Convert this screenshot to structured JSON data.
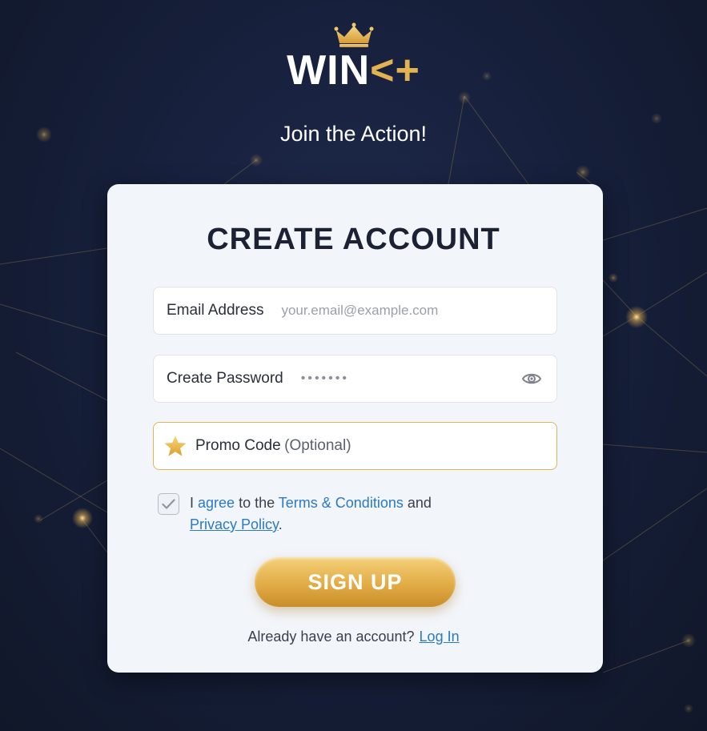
{
  "brand": {
    "logo_main": "WIN",
    "logo_accent": "<+",
    "tagline": "Join the Action!"
  },
  "form": {
    "title": "CREATE ACCOUNT",
    "email": {
      "label": "Email Address",
      "placeholder": "your.email@example.com"
    },
    "password": {
      "label": "Create Password",
      "masked_value": "•••••••"
    },
    "promo": {
      "label": "Promo Code",
      "optional": "(Optional)"
    },
    "agree": {
      "checked": true,
      "text_prefix": "I ",
      "agree_word": "agree",
      "text_mid": " to the ",
      "terms_link": "Terms & Conditions",
      "text_and": " and",
      "privacy_link": "Privacy Policy",
      "text_end": "."
    },
    "submit_label": "SIGN UP",
    "login_prompt": "Already have an account?",
    "login_link": "Log In"
  },
  "colors": {
    "background": "#17203c",
    "accent_gold": "#e3b352",
    "link_blue": "#2b7ac2",
    "card": "#f2f5fa"
  },
  "icons": [
    "crown-icon",
    "eye-icon",
    "star-icon",
    "check-icon"
  ]
}
